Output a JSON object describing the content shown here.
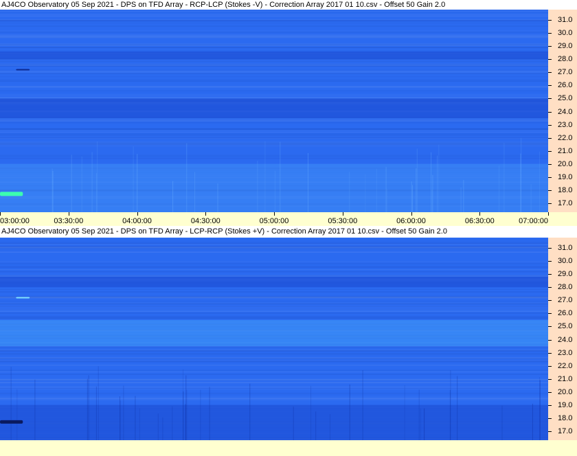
{
  "chart_data": [
    {
      "type": "heatmap",
      "title": "AJ4CO Observatory 05 Sep 2021  -  DPS on TFD Array  -  RCP-LCP (Stokes -V)  -  Correction Array 2017 01 10.csv  -  Offset 50  Gain 2.0",
      "x_ticks": [
        "03:00:00",
        "03:30:00",
        "04:00:00",
        "04:30:00",
        "05:00:00",
        "05:30:00",
        "06:00:00",
        "06:30:00",
        "07:00:00"
      ],
      "y_ticks": [
        "31.0",
        "30.0",
        "29.0",
        "28.0",
        "27.0",
        "26.0",
        "25.0",
        "24.0",
        "23.0",
        "22.0",
        "21.0",
        "20.0",
        "19.0",
        "18.0",
        "17.0"
      ],
      "x_range": [
        "03:00:00",
        "07:00:00"
      ],
      "y_range_mhz": [
        16.3,
        31.8
      ],
      "colors": {
        "base": "#2b6af0",
        "dark_band": "#1f52d8",
        "light": "#3f8ef8",
        "bright": "#3cffb0"
      },
      "bands_mhz": [
        {
          "from": 23.5,
          "to": 25.0,
          "level": "dark"
        },
        {
          "from": 28.0,
          "to": 28.6,
          "level": "dark"
        },
        {
          "from": 16.3,
          "to": 20.0,
          "level": "light"
        }
      ],
      "features": [
        {
          "time_start": "03:00:00",
          "time_end": "03:10:00",
          "freq_mhz": 17.7,
          "level": "bright"
        },
        {
          "time_start": "03:07:00",
          "time_end": "03:13:00",
          "freq_mhz": 27.2,
          "level": "dark"
        }
      ]
    },
    {
      "type": "heatmap",
      "title": "AJ4CO Observatory 05 Sep 2021  -  DPS on TFD Array  -  LCP-RCP (Stokes +V)  -  Correction Array 2017 01 10.csv  -  Offset 50  Gain 2.0",
      "x_ticks": [],
      "y_ticks": [
        "31.0",
        "30.0",
        "29.0",
        "28.0",
        "27.0",
        "26.0",
        "25.0",
        "24.0",
        "23.0",
        "22.0",
        "21.0",
        "20.0",
        "19.0",
        "18.0",
        "17.0"
      ],
      "x_range": [
        "03:00:00",
        "07:00:00"
      ],
      "y_range_mhz": [
        16.3,
        31.8
      ],
      "colors": {
        "base": "#2b6af0",
        "dark_band": "#1f52d8",
        "light": "#3f9afa",
        "dark_feature": "#0a1a60"
      },
      "bands_mhz": [
        {
          "from": 23.5,
          "to": 25.5,
          "level": "light"
        },
        {
          "from": 28.0,
          "to": 28.8,
          "level": "dark"
        },
        {
          "from": 16.3,
          "to": 19.0,
          "level": "dark"
        }
      ],
      "features": [
        {
          "time_start": "03:00:00",
          "time_end": "03:10:00",
          "freq_mhz": 17.7,
          "level": "very-dark"
        },
        {
          "time_start": "03:07:00",
          "time_end": "03:13:00",
          "freq_mhz": 27.2,
          "level": "bright"
        }
      ]
    }
  ]
}
